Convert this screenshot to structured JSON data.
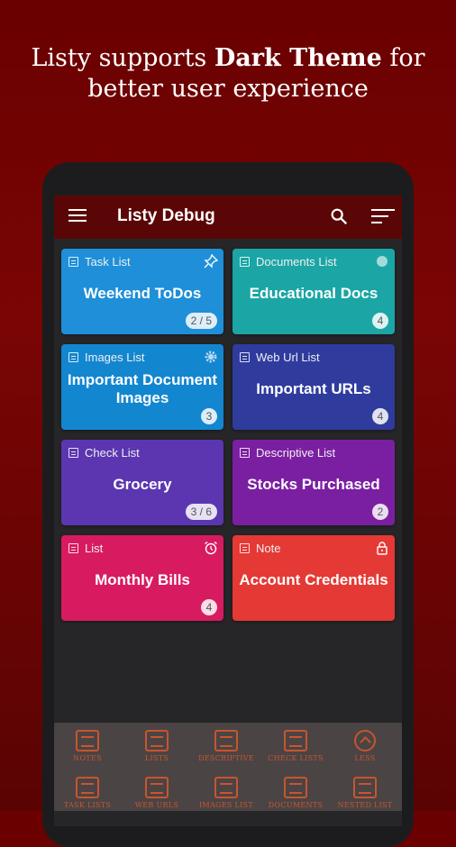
{
  "headline": {
    "line1_prefix": "Listy supports ",
    "line1_bold": "Dark Theme",
    "line1_suffix": " for",
    "line2": "better user experience"
  },
  "appbar": {
    "title": "Listy Debug",
    "menu_icon": "menu-icon",
    "search_icon": "search-icon",
    "sort_icon": "sort-icon"
  },
  "cards": [
    {
      "type": "Task List",
      "name": "Weekend ToDos",
      "badge": "2 / 5",
      "color": "#1e8fd8",
      "corner": "pin-icon"
    },
    {
      "type": "Documents List",
      "name": "Educational Docs",
      "badge": "4",
      "color": "#1ba5a5",
      "corner": "dot-icon"
    },
    {
      "type": "Images List",
      "name": "Important Document Images",
      "badge": "3",
      "color": "#1386d0",
      "corner": "gear-icon"
    },
    {
      "type": "Web Url List",
      "name": "Important URLs",
      "badge": "4",
      "color": "#2f3c9e",
      "corner": ""
    },
    {
      "type": "Check List",
      "name": "Grocery",
      "badge": "3 / 6",
      "color": "#5b36b0",
      "corner": ""
    },
    {
      "type": "Descriptive List",
      "name": "Stocks Purchased",
      "badge": "2",
      "color": "#7b1fa2",
      "corner": ""
    },
    {
      "type": "List",
      "name": "Monthly Bills",
      "badge": "4",
      "color": "#d81b60",
      "corner": "alarm-icon"
    },
    {
      "type": "Note",
      "name": "Account Credentials",
      "badge": "",
      "color": "#e53935",
      "corner": "lock-icon"
    }
  ],
  "bottom_menu": [
    {
      "label": "NOTES",
      "icon": "notes-icon"
    },
    {
      "label": "LISTS",
      "icon": "lists-icon"
    },
    {
      "label": "DESCRIPTIVE",
      "icon": "descriptive-icon"
    },
    {
      "label": "CHECK LISTS",
      "icon": "check-lists-icon"
    },
    {
      "label": "LESS",
      "icon": "chevron-up-icon"
    },
    {
      "label": "TASK LISTS",
      "icon": "task-lists-icon"
    },
    {
      "label": "WEB URLS",
      "icon": "web-urls-icon"
    },
    {
      "label": "IMAGES LIST",
      "icon": "images-list-icon"
    },
    {
      "label": "DOCUMENTS",
      "icon": "documents-icon"
    },
    {
      "label": "NESTED LIST",
      "icon": "nested-list-icon"
    }
  ],
  "colors": {
    "background": "#6a0000",
    "appbar": "#5b0606",
    "screen": "#262628",
    "bottom_accent": "#c9542e"
  }
}
